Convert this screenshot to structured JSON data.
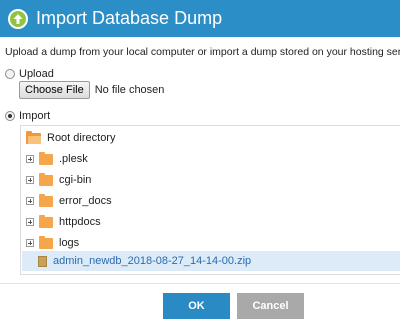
{
  "dialog": {
    "title": "Import Database Dump",
    "description": "Upload a dump from your local computer or import a dump stored on your hosting server."
  },
  "upload": {
    "label": "Upload",
    "selected": false,
    "choose_button": "Choose File",
    "file_status": "No file chosen"
  },
  "import": {
    "label": "Import",
    "selected": true
  },
  "tree": {
    "root": "Root directory",
    "folders": [
      ".plesk",
      "cgi-bin",
      "error_docs",
      "httpdocs",
      "logs"
    ],
    "file": "admin_newdb_2018-08-27_14-14-00.zip"
  },
  "buttons": {
    "ok": "OK",
    "cancel": "Cancel"
  },
  "colors": {
    "header": "#2b8ec6",
    "accent_icon": "#8fc43e",
    "ok": "#2a8ac3",
    "cancel": "#a9a9a9",
    "folder": "#f5a54a",
    "selection": "#dcebf7"
  },
  "icons": {
    "header": "upload-arrow-icon",
    "folder": "folder-icon",
    "file": "zip-file-icon"
  }
}
